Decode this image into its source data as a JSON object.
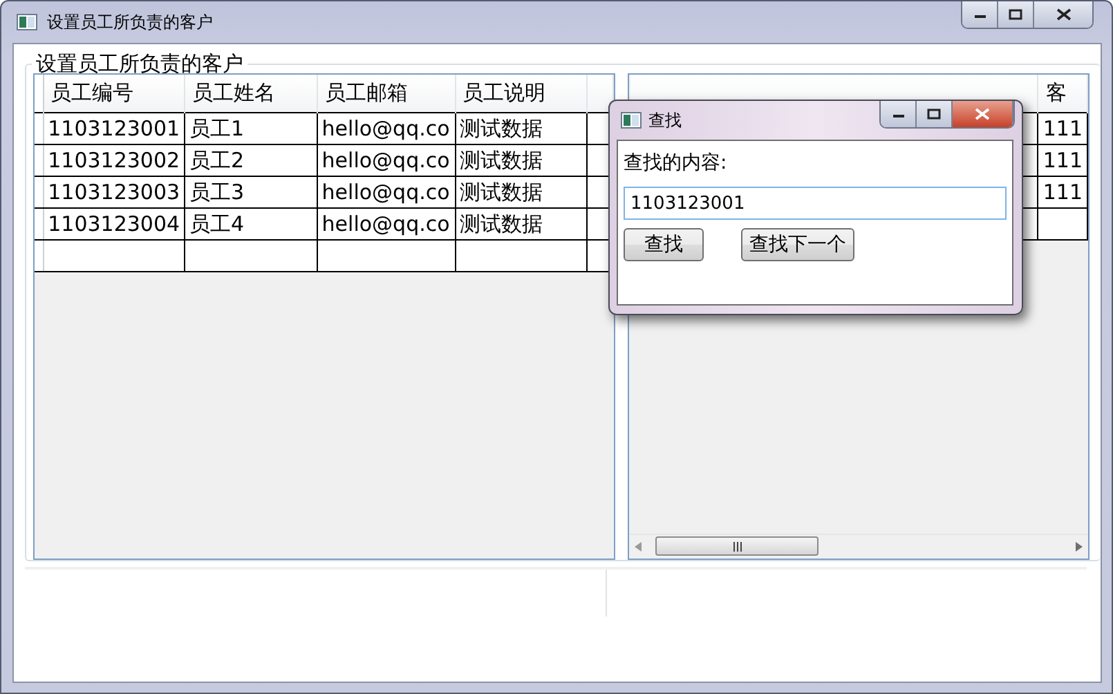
{
  "window": {
    "title": "设置员工所负责的客户"
  },
  "group": {
    "title": "设置员工所负责的客户"
  },
  "employees": {
    "columns": [
      "员工编号",
      "员工姓名",
      "员工邮箱",
      "员工说明"
    ],
    "rows": [
      [
        "1103123001",
        "员工1",
        "hello@qq.co",
        "测试数据"
      ],
      [
        "1103123002",
        "员工2",
        "hello@qq.co",
        "测试数据"
      ],
      [
        "1103123003",
        "员工3",
        "hello@qq.co",
        "测试数据"
      ],
      [
        "1103123004",
        "员工4",
        "hello@qq.co",
        "测试数据"
      ]
    ]
  },
  "customers": {
    "columns": [
      "客"
    ],
    "rows": [
      [
        "111"
      ],
      [
        "111"
      ],
      [
        "111"
      ]
    ]
  },
  "find_dialog": {
    "title": "查找",
    "label": "查找的内容:",
    "value": "1103123001",
    "buttons": [
      "查找",
      "查找下一个"
    ]
  }
}
